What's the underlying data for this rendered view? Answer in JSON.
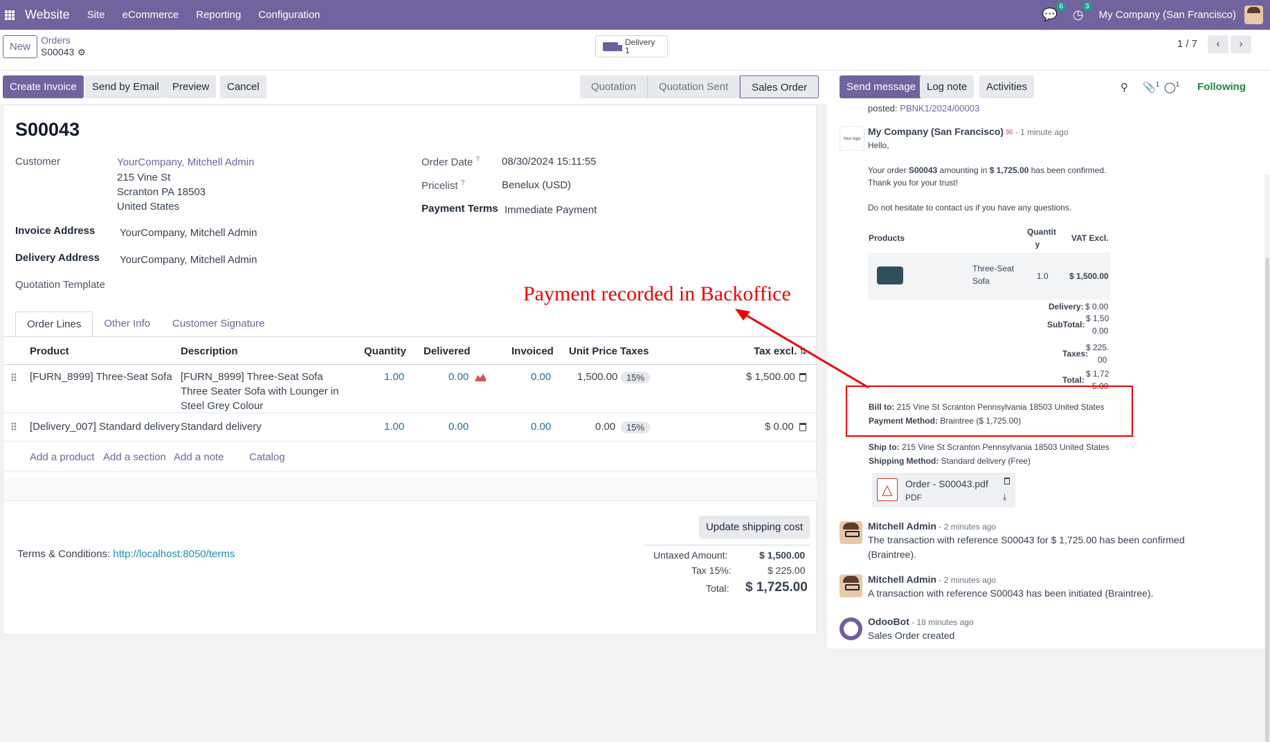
{
  "topbar": {
    "app": "Website",
    "menus": [
      "Site",
      "eCommerce",
      "Reporting",
      "Configuration"
    ],
    "chat_count": "6",
    "activity_count": "3",
    "company": "My Company (San Francisco)"
  },
  "control": {
    "new_label": "New",
    "breadcrumb": "Orders",
    "record": "S00043",
    "delivery_label": "Delivery",
    "delivery_count": "1",
    "pager": "1 / 7"
  },
  "actions": {
    "create_invoice": "Create Invoice",
    "send_email": "Send by Email",
    "preview": "Preview",
    "cancel": "Cancel"
  },
  "statusbar": [
    "Quotation",
    "Quotation Sent",
    "Sales Order"
  ],
  "form": {
    "name": "S00043",
    "customer_label": "Customer",
    "customer": "YourCompany, Mitchell Admin",
    "addr1": "215 Vine St",
    "addr2": "Scranton PA 18503",
    "addr3": "United States",
    "invoice_label": "Invoice Address",
    "invoice": "YourCompany, Mitchell Admin",
    "delivery_label": "Delivery Address",
    "delivery": "YourCompany, Mitchell Admin",
    "template_label": "Quotation Template",
    "order_date_label": "Order Date",
    "order_date": "08/30/2024 15:11:55",
    "pricelist_label": "Pricelist",
    "pricelist": "Benelux (USD)",
    "terms_label": "Payment Terms",
    "terms": "Immediate Payment",
    "help": "?"
  },
  "tabs": [
    "Order Lines",
    "Other Info",
    "Customer Signature"
  ],
  "columns": [
    "Product",
    "Description",
    "Quantity",
    "Delivered",
    "Invoiced",
    "Unit Price",
    "Taxes",
    "Tax excl."
  ],
  "lines": [
    {
      "product": "[FURN_8999] Three-Seat Sofa",
      "desc1": "[FURN_8999] Three-Seat Sofa",
      "desc2": "Three Seater Sofa with Lounger in",
      "desc3": "Steel Grey Colour",
      "qty": "1.00",
      "delivered": "0.00",
      "invoiced": "0.00",
      "price": "1,500.00",
      "tax": "15%",
      "subtotal": "$ 1,500.00"
    },
    {
      "product": "[Delivery_007] Standard delivery",
      "desc1": "Standard delivery",
      "qty": "1.00",
      "delivered": "0.00",
      "invoiced": "0.00",
      "price": "0.00",
      "tax": "15%",
      "subtotal": "$ 0.00"
    }
  ],
  "add_links": [
    "Add a product",
    "Add a section",
    "Add a note",
    "Catalog"
  ],
  "update_shipping": "Update shipping cost",
  "terms": {
    "label": "Terms & Conditions:",
    "url": "http://localhost:8050/terms"
  },
  "totals": {
    "untaxed_label": "Untaxed Amount:",
    "untaxed": "$ 1,500.00",
    "tax_label": "Tax 15%:",
    "tax": "$ 225.00",
    "total_label": "Total:",
    "total": "$ 1,725.00"
  },
  "chatter": {
    "send_message": "Send message",
    "log_note": "Log note",
    "activities": "Activities",
    "attach_count": "1",
    "follower_count": "1",
    "following": "Following",
    "posted": "posted:",
    "posted_ref": "PBNK1/2024/00003",
    "m1_author": "My Company (San Francisco)",
    "m1_ago": "- 1 minute ago",
    "logo_text": "Your logo",
    "m1_hello": "Hello,",
    "m1_p1a": "Your order ",
    "m1_order": "S00043",
    "m1_p1b": " amounting in ",
    "m1_amount": "$ 1,725.00",
    "m1_p1c": " has been confirmed.",
    "m1_thanks": "Thank you for your trust!",
    "m1_contact": "Do not hesitate to contact us if you have any questions.",
    "tbl_products": "Products",
    "tbl_qty1": "Quantit",
    "tbl_qty2": "y",
    "tbl_vat": "VAT Excl.",
    "tbl_item1": "Three-Seat",
    "tbl_item2": "Sofa",
    "tbl_item_qty": "1.0",
    "tbl_item_price": "$ 1,500.00",
    "delivery_label": "Delivery:",
    "delivery_val": "$ 0.00",
    "subtotal_label": "SubTotal:",
    "subtotal_a": "$ 1,50",
    "subtotal_b": "0.00",
    "taxes_label": "Taxes:",
    "taxes_a": "$ 225.",
    "taxes_b": "00",
    "total_label": "Total:",
    "total_a": "$ 1,72",
    "total_b": "5.00",
    "bill_label": "Bill to:",
    "bill_val": "215 Vine St Scranton Pennsylvania 18503 United States",
    "paym_label": "Payment Method:",
    "paym_val": "Braintree ($ 1,725.00)",
    "ship_label": "Ship to:",
    "ship_val": "215 Vine St Scranton Pennsylvania 18503 United States",
    "shipm_label": "Shipping Method:",
    "shipm_val": "Standard delivery (Free)",
    "pdf_name": "Order - S00043.pdf",
    "pdf_type": "PDF",
    "m2_author": "Mitchell Admin",
    "m2_ago": "- 2 minutes ago",
    "m2_text1": "The transaction with reference S00043 for $ 1,725.00 has been confirmed",
    "m2_text2": "(Braintree).",
    "m3_author": "Mitchell Admin",
    "m3_ago": "- 2 minutes ago",
    "m3_text": "A transaction with reference S00043 has been initiated (Braintree).",
    "m4_author": "OdooBot",
    "m4_ago": "- 18 minutes ago",
    "m4_text": "Sales Order created"
  },
  "annotation": "Payment recorded in Backoffice",
  "colors": {
    "brand": "#71639e",
    "annotation": "#e00000",
    "following": "#1a8a3c"
  },
  "icons": [
    "apps-icon",
    "chat-icon",
    "activity-icon",
    "gear-icon",
    "truck-icon",
    "search-icon",
    "paperclip-icon",
    "follower-icon",
    "trash-icon",
    "chart-icon",
    "pdf-icon",
    "download-icon",
    "email-icon"
  ]
}
